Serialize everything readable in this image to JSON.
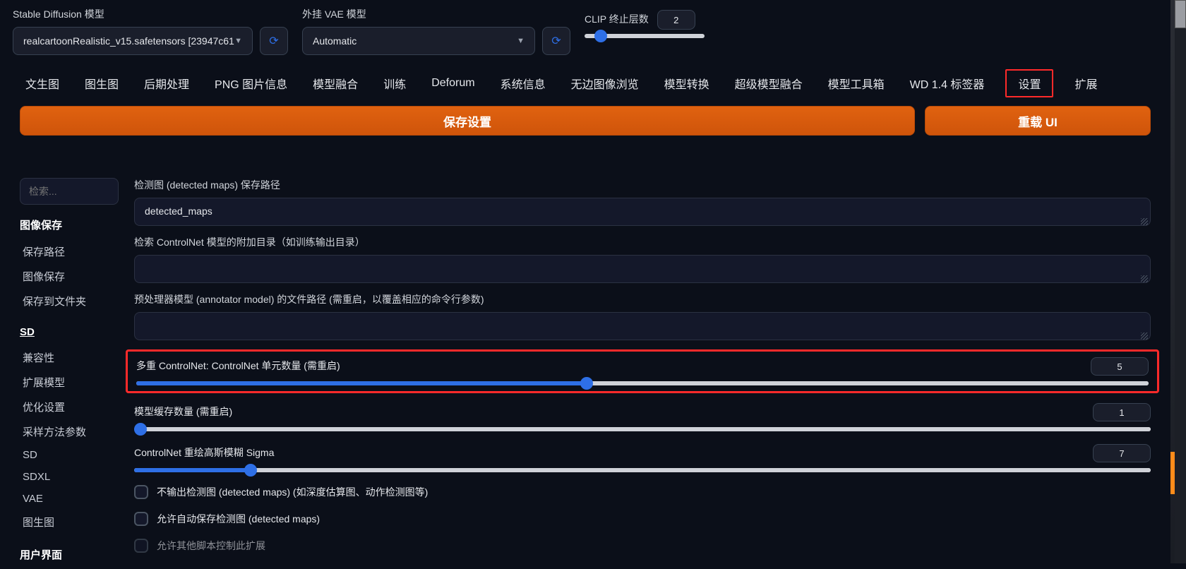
{
  "top": {
    "sd_label": "Stable Diffusion 模型",
    "sd_model": "realcartoonRealistic_v15.safetensors [23947c61",
    "vae_label": "外挂 VAE 模型",
    "vae_model": "Automatic",
    "clip_label": "CLIP 终止层数",
    "clip_value": "2"
  },
  "tabs": [
    "文生图",
    "图生图",
    "后期处理",
    "PNG 图片信息",
    "模型融合",
    "训练",
    "Deforum",
    "系统信息",
    "无边图像浏览",
    "模型转换",
    "超级模型融合",
    "模型工具箱",
    "WD 1.4 标签器",
    "设置",
    "扩展"
  ],
  "active_tab_index": 13,
  "buttons": {
    "save": "保存设置",
    "reload": "重载 UI"
  },
  "search_placeholder": "检索...",
  "sidebar": {
    "group1_header": "图像保存",
    "group1": [
      "保存路径",
      "图像保存",
      "保存到文件夹"
    ],
    "group2_header": "SD",
    "group2": [
      "兼容性",
      "扩展模型",
      "优化设置",
      "采样方法参数",
      "SD",
      "SDXL",
      "VAE",
      "图生图"
    ],
    "group3_header": "用户界面"
  },
  "fields": {
    "detected_maps_label": "检测图 (detected maps) 保存路径",
    "detected_maps_value": "detected_maps",
    "extra_dir_label": "检索 ControlNet 模型的附加目录（如训练输出目录）",
    "extra_dir_value": "",
    "annotator_label": "预处理器模型 (annotator model) 的文件路径 (需重启，以覆盖相应的命令行参数)",
    "annotator_value": ""
  },
  "sliders": {
    "units": {
      "label": "多重 ControlNet: ControlNet 单元数量 (需重启)",
      "value": "5"
    },
    "cache": {
      "label": "模型缓存数量 (需重启)",
      "value": "1"
    },
    "sigma": {
      "label": "ControlNet 重绘高斯模糊 Sigma",
      "value": "7"
    }
  },
  "checks": {
    "no_output": "不输出检测图 (detected maps) (如深度估算图、动作检测图等)",
    "auto_save": "允许自动保存检测图 (detected maps)",
    "other": "允许其他脚本控制此扩展"
  }
}
